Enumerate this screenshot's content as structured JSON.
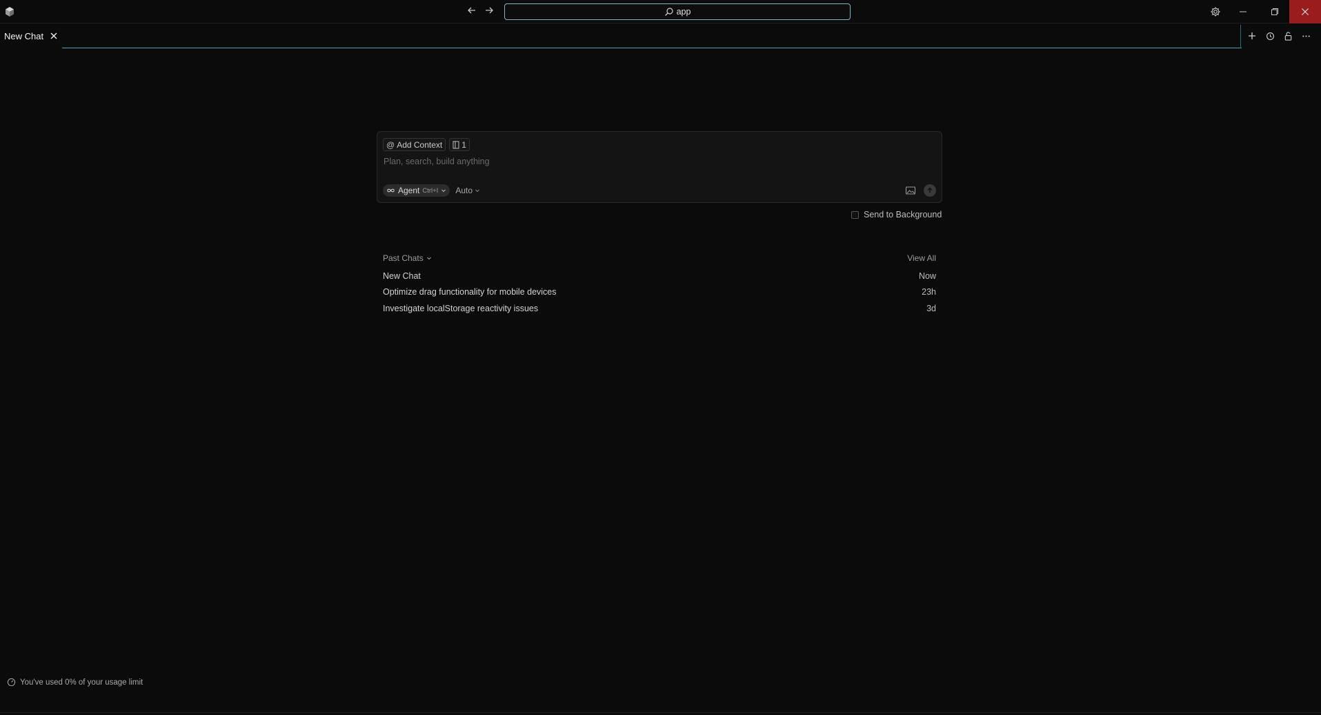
{
  "titlebar": {
    "search_text": "app",
    "close_color": "#9b1c1c",
    "search_border_color": "#7fb6c4"
  },
  "tabs": [
    {
      "label": "New Chat",
      "active": true
    }
  ],
  "composer": {
    "add_context_label": "Add Context",
    "file_count": "1",
    "placeholder": "Plan, search, build anything",
    "agent_label": "Agent",
    "agent_shortcut": "Ctrl+I",
    "model_label": "Auto"
  },
  "send_to_background": {
    "label": "Send to Background",
    "checked": false
  },
  "past_chats": {
    "title": "Past Chats",
    "view_all_label": "View All",
    "items": [
      {
        "title": "New Chat",
        "time": "Now"
      },
      {
        "title": "Optimize drag functionality for mobile devices",
        "time": "23h"
      },
      {
        "title": "Investigate localStorage reactivity issues",
        "time": "3d"
      }
    ]
  },
  "footer": {
    "usage_text": "You've used 0% of your usage limit"
  },
  "icons": {
    "app": "app-logo-icon",
    "back": "arrow-left-icon",
    "forward": "arrow-right-icon",
    "search": "search-icon",
    "settings": "gear-icon",
    "minimize": "minimize-icon",
    "restore": "restore-icon",
    "close": "close-icon",
    "new_tab": "plus-icon",
    "history": "history-icon",
    "lock": "unlock-icon",
    "more": "ellipsis-icon",
    "image": "image-icon",
    "send": "arrow-up-icon",
    "usage": "gauge-icon"
  }
}
